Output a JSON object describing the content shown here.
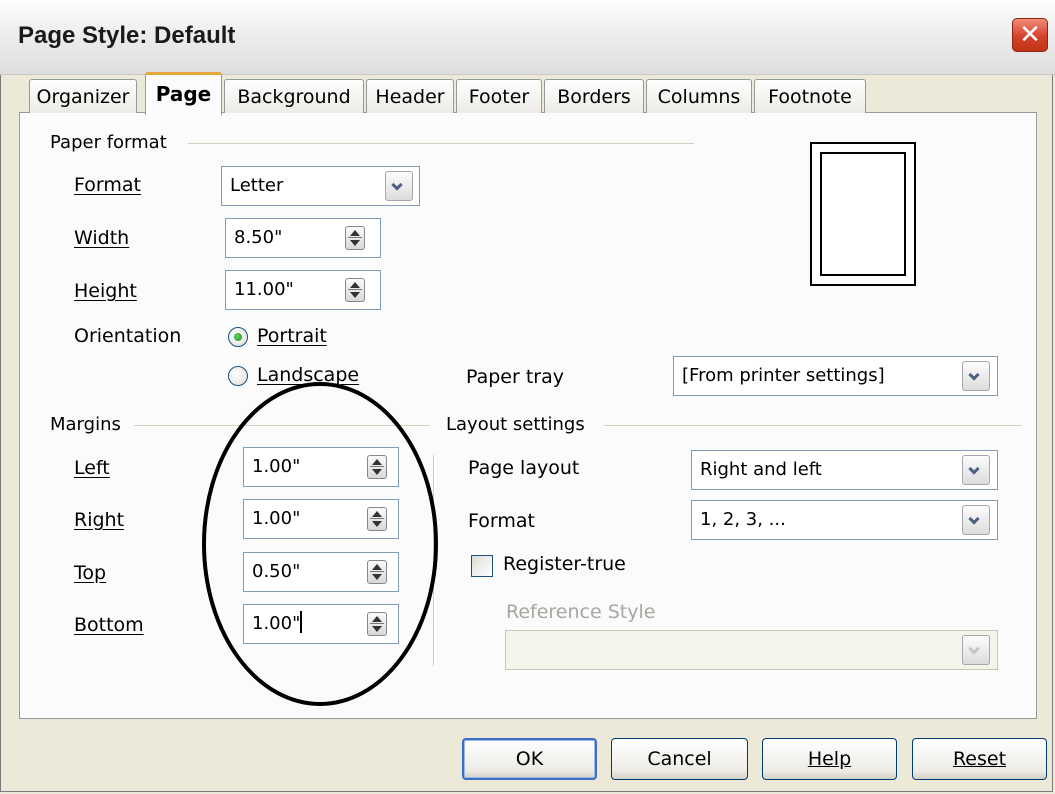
{
  "window": {
    "title": "Page Style: Default",
    "close_glyph": "✕"
  },
  "tabs": [
    {
      "label": "Organizer"
    },
    {
      "label": "Page",
      "active": true
    },
    {
      "label": "Background"
    },
    {
      "label": "Header"
    },
    {
      "label": "Footer"
    },
    {
      "label": "Borders"
    },
    {
      "label": "Columns"
    },
    {
      "label": "Footnote"
    }
  ],
  "paper_format": {
    "group_label": "Paper format",
    "format": {
      "label": "Format",
      "value": "Letter"
    },
    "width": {
      "label": "Width",
      "value": "8.50\""
    },
    "height": {
      "label": "Height",
      "value": "11.00\""
    },
    "orientation": {
      "label": "Orientation",
      "portrait": "Portrait",
      "landscape": "Landscape",
      "selected": "Portrait"
    },
    "paper_tray": {
      "label": "Paper tray",
      "value": "[From printer settings]"
    }
  },
  "margins": {
    "group_label": "Margins",
    "left": {
      "label": "Left",
      "value": "1.00\""
    },
    "right": {
      "label": "Right",
      "value": "1.00\""
    },
    "top": {
      "label": "Top",
      "value": "0.50\""
    },
    "bottom": {
      "label": "Bottom",
      "value": "1.00\""
    }
  },
  "layout_settings": {
    "group_label": "Layout settings",
    "page_layout": {
      "label": "Page layout",
      "value": "Right and left"
    },
    "format": {
      "label": "Format",
      "value": "1, 2, 3, ..."
    },
    "register_true": {
      "label": "Register-true",
      "checked": false
    },
    "reference_style": {
      "label": "Reference Style",
      "value": "",
      "disabled": true
    }
  },
  "buttons": {
    "ok": "OK",
    "cancel": "Cancel",
    "help": "Help",
    "reset": "Reset"
  },
  "colors": {
    "annotation_ellipse": "#000000",
    "active_tab_accent": "#e8a63e",
    "close_button": "#d5402a"
  }
}
